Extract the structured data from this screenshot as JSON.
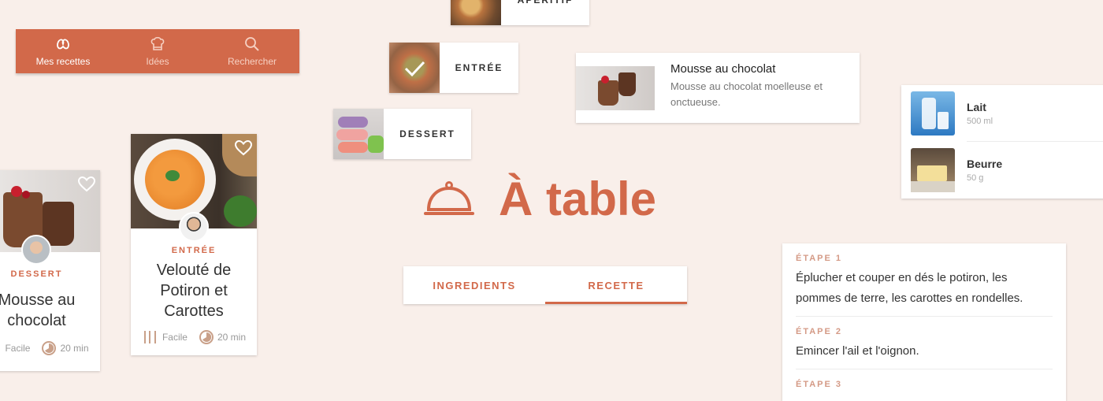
{
  "nav": {
    "items": [
      {
        "label": "Mes recettes",
        "icon": "pretzel-icon",
        "active": true
      },
      {
        "label": "Idées",
        "icon": "chef-hat-icon",
        "active": false
      },
      {
        "label": "Rechercher",
        "icon": "search-icon",
        "active": false
      }
    ]
  },
  "categories": {
    "aperitif": "APÉRITIF",
    "entree": "ENTRÉE",
    "dessert": "DESSERT"
  },
  "list_item": {
    "title": "Mousse au chocolat",
    "description": "Mousse au chocolat moelleuse et onctueuse."
  },
  "ingredients": [
    {
      "name": "Lait",
      "quantity": "500 ml"
    },
    {
      "name": "Beurre",
      "quantity": "50 g"
    }
  ],
  "logo": {
    "text": "À table",
    "icon": "cloche-icon"
  },
  "tabs": [
    {
      "label": "INGREDIENTS",
      "active": false
    },
    {
      "label": "RECETTE",
      "active": true
    }
  ],
  "card_dessert": {
    "category": "DESSERT",
    "title": "Mousse au chocolat",
    "difficulty": "Facile",
    "time": "20 min"
  },
  "card_entree": {
    "category": "ENTRÉE",
    "title": "Velouté de Potiron et Carottes",
    "difficulty": "Facile",
    "time": "20 min"
  },
  "steps": [
    {
      "label": "ÉTAPE 1",
      "text": "Éplucher et couper en dés le potiron, les pommes de terre, les carottes en rondelles."
    },
    {
      "label": "ÉTAPE 2",
      "text": "Emincer l'ail et l'oignon."
    },
    {
      "label": "ÉTAPE 3",
      "text": ""
    }
  ],
  "colors": {
    "background": "#f9efea",
    "accent": "#d2694a",
    "step_label": "#d49a86"
  }
}
